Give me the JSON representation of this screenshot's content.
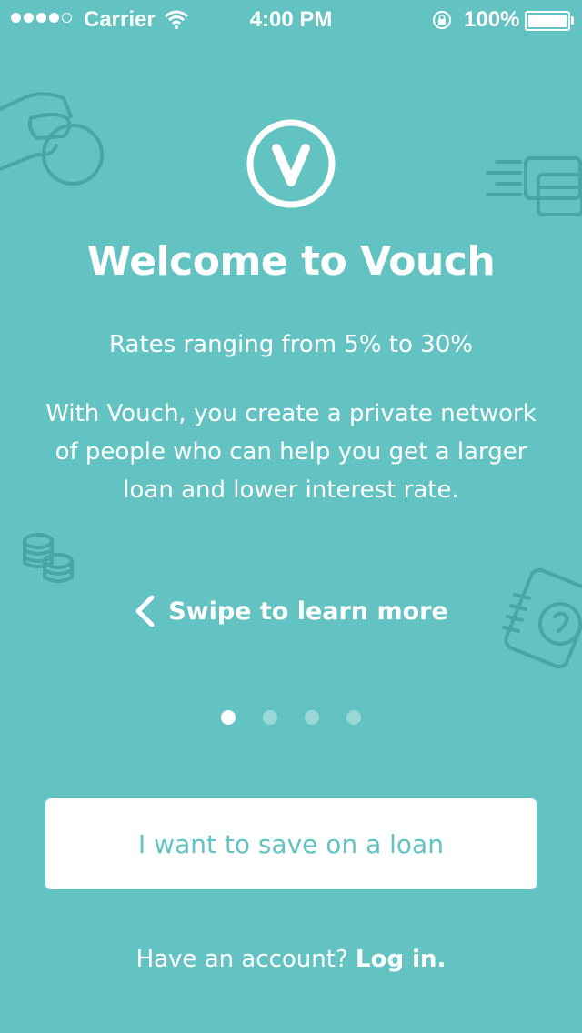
{
  "status_bar": {
    "carrier": "Carrier",
    "time": "4:00 PM",
    "battery": "100%",
    "signal_bars": 4,
    "signal_total": 5
  },
  "onboarding": {
    "title": "Welcome to Vouch",
    "subtitle": "Rates ranging from 5% to 30%",
    "description": "With Vouch, you create a private network of people who can help you get a larger loan and lower interest rate.",
    "swipe_hint": "Swipe to learn more",
    "page_count": 4,
    "active_page": 1
  },
  "actions": {
    "primary_button": "I want to save on a loan",
    "account_prompt": "Have an account?",
    "login_link": "Log in."
  },
  "colors": {
    "background": "#63c3c2",
    "button_text": "#63c3c2",
    "decoration": "#4aa5a6"
  },
  "icons": [
    "signal-dots-icon",
    "wifi-icon",
    "rotation-lock-icon",
    "battery-icon",
    "vouch-logo-icon",
    "hand-coin-icon",
    "credit-cards-icon",
    "coin-stack-icon",
    "notebook-icon",
    "chevron-left-icon"
  ]
}
